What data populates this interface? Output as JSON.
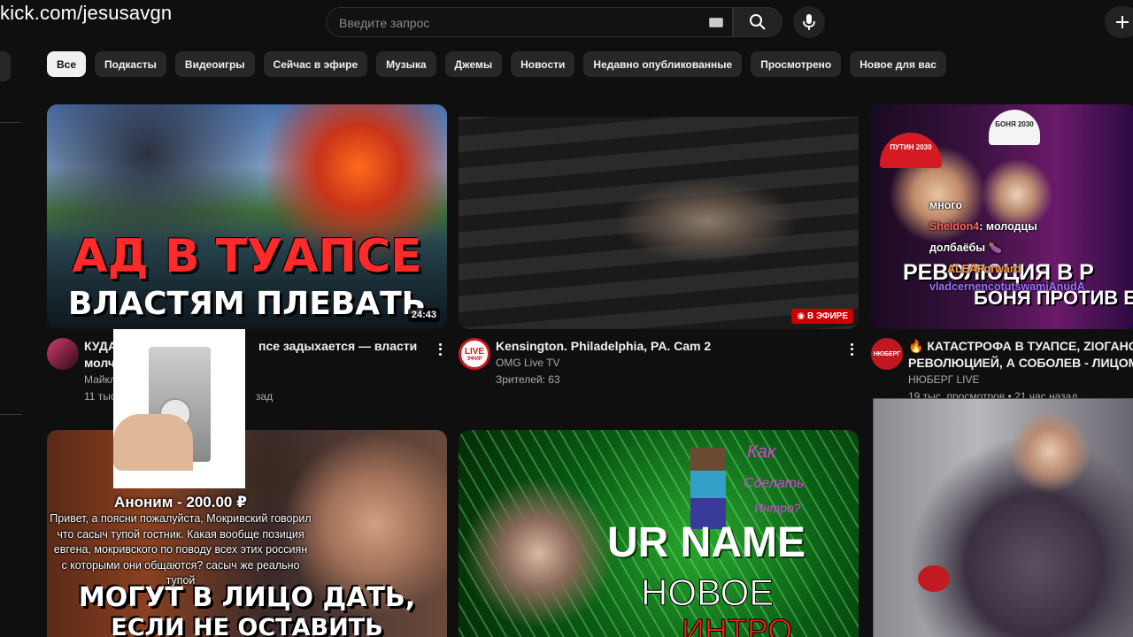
{
  "overlay": {
    "stream_url": "kick.com/jesusavgn"
  },
  "header": {
    "search_placeholder": "Введите запрос"
  },
  "chips": [
    "Все",
    "Подкасты",
    "Видеоигры",
    "Сейчас в эфире",
    "Музыка",
    "Джемы",
    "Новости",
    "Недавно опубликованные",
    "Просмотрено",
    "Новое для вас"
  ],
  "videos": [
    {
      "thumb_line1": "АД В ТУАПСЕ",
      "thumb_line2": "ВЛАСТЯМ ПЛЕВАТЬ",
      "duration": "24:43",
      "title_a": "КУДА",
      "title_b": "псе задыхается — власти",
      "title_c": "молч",
      "channel": "Майкл",
      "stats_tail": "зад"
    },
    {
      "live_badge": "В ЭФИРЕ",
      "avatar_text": "LIVE",
      "avatar_sub": "ЭФИР",
      "title": "Kensington. Philadelphia, PA. Cam 2",
      "channel": "OMG Live TV",
      "stats": "Зрителей: 63"
    },
    {
      "thumb_text": "РЕВОЛЮЦИЯ В Р",
      "thumb_text2": "БОНЯ ПРОТИВ Б",
      "cap_text": "ПУТИН 2030",
      "cap_text2": "БОНЯ 2030",
      "avatar_text": "НЮБЕРГ",
      "title_line1": "🔥 КАТАСТРОФА В ТУАПСЕ, ZIОГАНОВ П",
      "title_line2": "РЕВОЛЮЦИЕЙ, А СОБОЛЕВ - ЛИЦОМ І М",
      "channel": "НЮБЕРГ LIVE",
      "stats": "19 тыс. просмотров • 21 час назад"
    },
    {
      "thumb_line1": "МОГУТ В ЛИЦО ДАТЬ,",
      "thumb_line2": "ЕСЛИ НЕ ОСТАВИТЬ ЧАЕВЫЕ?"
    },
    {
      "thumb_name": "UR NAME",
      "thumb_new": "НОВОЕ",
      "thumb_intro": "ИНТРО",
      "thumb_how1": "Как",
      "thumb_how2": "Сделать",
      "thumb_how3": "Интро?"
    }
  ],
  "chat": [
    {
      "text": "много",
      "color": "#ffffff"
    },
    {
      "user": "Sheldon4",
      "text": ": молодцы",
      "user_color": "#ff6060"
    },
    {
      "text": "долбаёбы 🍆",
      "color": "#ffffff"
    },
    {
      "user": "ALEAForward",
      "text": "",
      "user_color": "#ff9a3c"
    },
    {
      "user": "vladcernencotutswamiAnudA",
      "text": "",
      "user_color": "#a070ff"
    }
  ],
  "donation": {
    "name": "Аноним - 200.00 ₽",
    "message": "Привет, а поясни пожалуйста, Мокривский говорил что сасыч тупой гостник. Какая вообще позиция евгена, мокривского по поводу всех этих россиян с которыми они общаются? сасыч же реально тупой"
  },
  "colors": {
    "background": "#0f0f0f",
    "chip": "#272727",
    "chip_active": "#f1f1f1",
    "live_red": "#cc0000",
    "accent_red": "#e4202a"
  }
}
